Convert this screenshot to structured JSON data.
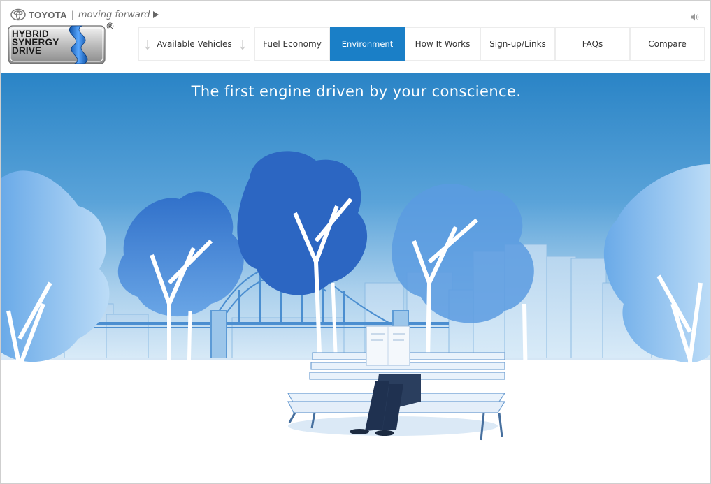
{
  "brand": {
    "name": "TOYOTA",
    "separator": "|",
    "tagline": "moving forward",
    "logo_icon": "toyota-emblem-icon"
  },
  "product_logo": {
    "lines": [
      "HYBRID",
      "SYNERGY",
      "DRIVE"
    ],
    "registered_mark": "®"
  },
  "audio": {
    "icon": "speaker-icon"
  },
  "nav": {
    "available_vehicles": "Available Vehicles",
    "fuel_economy": "Fuel Economy",
    "environment": "Environment",
    "how_it_works": "How It Works",
    "signup_links": "Sign-up/Links",
    "faqs": "FAQs",
    "compare": "Compare",
    "active": "Environment"
  },
  "hero": {
    "headline": "The first engine driven by your conscience."
  },
  "colors": {
    "accent": "#1a7fc7",
    "sky_top": "#2e86c8",
    "sky_bottom": "#b9d9f0",
    "tree_blue": "#3a7fd0",
    "ground": "#ffffff"
  }
}
